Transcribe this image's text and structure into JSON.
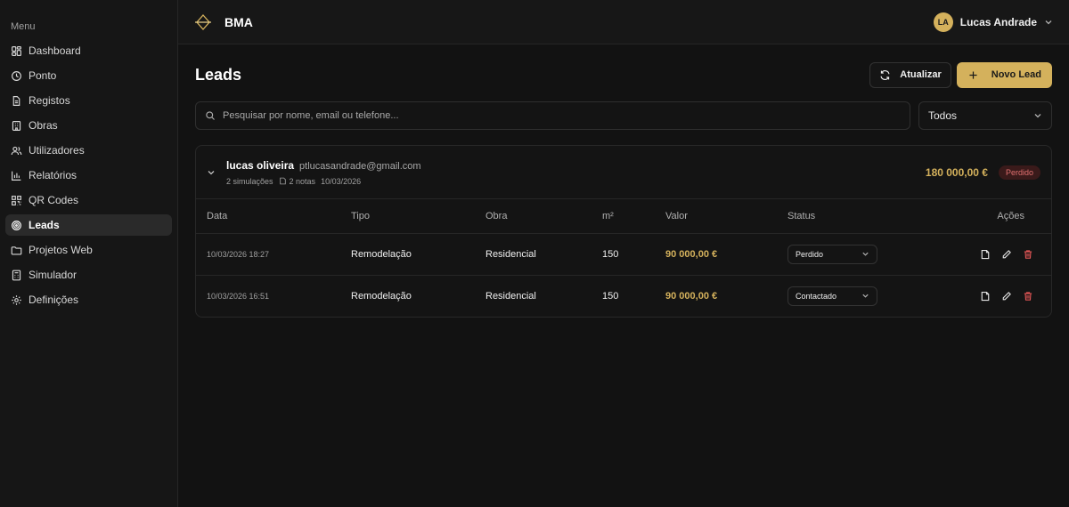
{
  "sidebar": {
    "menu_label": "Menu",
    "items": [
      {
        "label": "Dashboard"
      },
      {
        "label": "Ponto"
      },
      {
        "label": "Registos"
      },
      {
        "label": "Obras"
      },
      {
        "label": "Utilizadores"
      },
      {
        "label": "Relatórios"
      },
      {
        "label": "QR Codes"
      },
      {
        "label": "Leads"
      },
      {
        "label": "Projetos Web"
      },
      {
        "label": "Simulador"
      },
      {
        "label": "Definições"
      }
    ],
    "active_index": 7
  },
  "header": {
    "brand": "BMA",
    "user_initials": "LA",
    "user_name": "Lucas Andrade"
  },
  "page": {
    "title": "Leads",
    "refresh_label": "Atualizar",
    "new_label": "Novo Lead"
  },
  "filters": {
    "search_placeholder": "Pesquisar por nome, email ou telefone...",
    "status_filter": "Todos"
  },
  "lead": {
    "name": "lucas oliveira",
    "email": "ptlucasandrade@gmail.com",
    "simulations": "2 simulações",
    "notes": "2 notas",
    "date": "10/03/2026",
    "total": "180 000,00 €",
    "status": "Perdido"
  },
  "table": {
    "headers": {
      "data": "Data",
      "tipo": "Tipo",
      "obra": "Obra",
      "area": "m²",
      "valor": "Valor",
      "status": "Status",
      "acoes": "Ações"
    },
    "rows": [
      {
        "data": "10/03/2026 18:27",
        "tipo": "Remodelação",
        "obra": "Residencial",
        "area": "150",
        "valor": "90 000,00 €",
        "status": "Perdido"
      },
      {
        "data": "10/03/2026 16:51",
        "tipo": "Remodelação",
        "obra": "Residencial",
        "area": "150",
        "valor": "90 000,00 €",
        "status": "Contactado"
      }
    ]
  },
  "colors": {
    "accent": "#d4b15c",
    "danger": "#e05555",
    "background": "#121212"
  }
}
